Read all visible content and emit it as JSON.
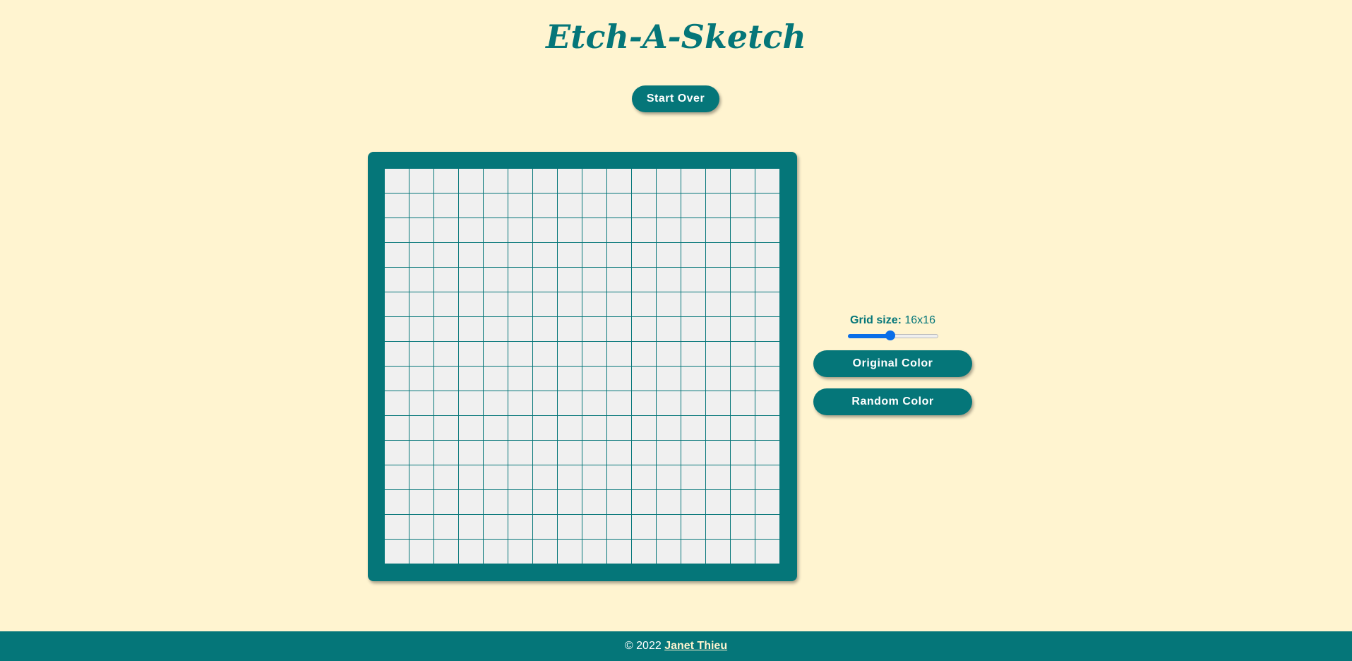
{
  "header": {
    "title": "Etch-A-Sketch",
    "start_over_label": "Start Over"
  },
  "board": {
    "rows": 16,
    "cols": 16,
    "cell_color": "#f0f0f0",
    "line_color": "#057679"
  },
  "controls": {
    "grid_size_label": "Grid size:",
    "grid_size_value": "16x16",
    "slider_level": 0.48,
    "original_color_label": "Original Color",
    "random_color_label": "Random Color"
  },
  "footer": {
    "copyright": "© 2022",
    "author": "Janet Thieu"
  },
  "colors": {
    "background": "#fff4d0",
    "accent": "#057679",
    "slider_accent": "#0a6ee8"
  }
}
